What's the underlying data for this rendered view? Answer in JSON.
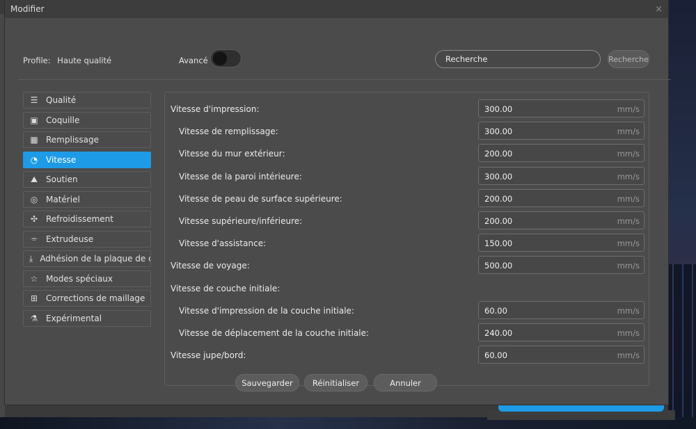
{
  "dialog": {
    "title": "Modifier",
    "close_glyph": "×"
  },
  "top": {
    "profile_label": "Profile:",
    "profile_value": "Haute qualité",
    "advanced_label": "Avancé",
    "advanced_on": false,
    "search_value": "Recherche",
    "search_button": "Recherche"
  },
  "sidebar": {
    "items": [
      {
        "label": "Qualité",
        "icon": "quality-icon",
        "glyph": "☰"
      },
      {
        "label": "Coquille",
        "icon": "shell-icon",
        "glyph": "▣"
      },
      {
        "label": "Remplissage",
        "icon": "infill-icon",
        "glyph": "▦"
      },
      {
        "label": "Vitesse",
        "icon": "speed-icon",
        "glyph": "◔",
        "active": true
      },
      {
        "label": "Soutien",
        "icon": "support-icon",
        "glyph": "⛰"
      },
      {
        "label": "Matériel",
        "icon": "material-icon",
        "glyph": "◎"
      },
      {
        "label": "Refroidissement",
        "icon": "cooling-fan-icon",
        "glyph": "✣"
      },
      {
        "label": "Extrudeuse",
        "icon": "extruder-icon",
        "glyph": "⌯"
      },
      {
        "label": "Adhésion de la plaque de cc",
        "icon": "adhesion-icon",
        "glyph": "⤓"
      },
      {
        "label": "Modes spéciaux",
        "icon": "star-icon",
        "glyph": "☆"
      },
      {
        "label": "Corrections de maillage",
        "icon": "mesh-fix-icon",
        "glyph": "⊞"
      },
      {
        "label": "Expérimental",
        "icon": "flask-icon",
        "glyph": "⚗"
      }
    ]
  },
  "speed": {
    "unit": "mm/s",
    "rows": [
      {
        "label": "Vitesse d'impression:",
        "value": "300.00"
      },
      {
        "label": "Vitesse de remplissage:",
        "value": "300.00"
      },
      {
        "label": "Vitesse du mur extérieur:",
        "value": "200.00"
      },
      {
        "label": "Vitesse de la paroi intérieure:",
        "value": "300.00"
      },
      {
        "label": "Vitesse de peau de surface supérieure:",
        "value": "200.00"
      },
      {
        "label": "Vitesse supérieure/inférieure:",
        "value": "200.00"
      },
      {
        "label": "Vitesse d'assistance:",
        "value": "150.00"
      },
      {
        "label": "Vitesse de voyage:",
        "value": "500.00"
      },
      {
        "label": "Vitesse de couche initiale:"
      },
      {
        "label": "Vitesse d'impression de la couche initiale:",
        "value": "60.00"
      },
      {
        "label": "Vitesse de déplacement de la couche initiale:",
        "value": "240.00"
      },
      {
        "label": "Vitesse jupe/bord:",
        "value": "60.00"
      }
    ]
  },
  "footer": {
    "save": "Sauvegarder",
    "reset": "Réinitialiser",
    "cancel": "Annuler"
  },
  "colors": {
    "accent": "#1e9be6",
    "dialog_bg": "#4b4b4b",
    "titlebar_bg": "#3d3d3d"
  }
}
